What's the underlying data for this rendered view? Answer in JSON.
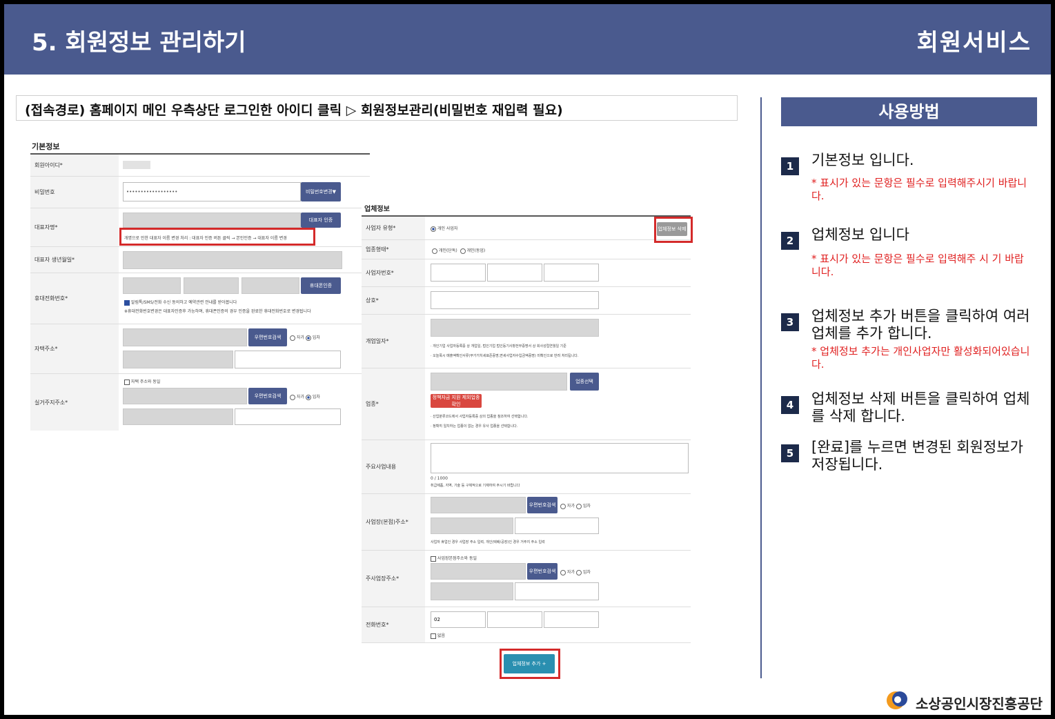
{
  "header": {
    "title": "5. 회원정보 관리하기",
    "section": "회원서비스"
  },
  "path": "(접속경로) 홈페이지 메인 우측상단 로그인한 아이디 클릭 ▷ 회원정보관리(비밀번호 재입력 필요)",
  "howto": {
    "title": "사용방법",
    "steps": [
      {
        "num": "1",
        "text": "기본정보 입니다.",
        "note": "* 표시가 있는 문항은 필수로 입력해주시기 바랍니다."
      },
      {
        "num": "2",
        "text": "업체정보 입니다",
        "note": "* 표시가 있는 문항은 필수로 입력해주 시 기 바랍니다."
      },
      {
        "num": "3",
        "text": "업체정보 추가 버튼을 클릭하여 여러 업체를 추가 합니다.",
        "note": "* 업체정보 추가는 개인사업자만 활성화되어있습니다."
      },
      {
        "num": "4",
        "text": "업체정보 삭제 버튼을 클릭하여 업체를 삭제 합니다.",
        "note": ""
      },
      {
        "num": "5",
        "text": "[완료]를 누르면 변경된 회원정보가 저장됩니다.",
        "note": ""
      }
    ]
  },
  "basic": {
    "heading": "기본정보",
    "labels": {
      "id": "회원아이디*",
      "pw": "비밀번호",
      "rep": "대표자명*",
      "birth": "대표자 생년월일*",
      "phone": "휴대전화번호*",
      "home": "자택주소*",
      "real": "실거주지주소*"
    },
    "pw_value": "••••••••••••••••••",
    "btn_pw": "비밀번호변경▼",
    "btn_rep": "대표자 인증",
    "rep_notice": "개명으로 인한 대표자 이름 변경 처리 : 대표자 인증 버튼 클릭 → 본인인증 → 대표자 이름 변경",
    "btn_phone": "휴대폰인증",
    "phone_agree": "알림톡/SMS/전화 수신 동의하고 예약관련 안내를 받아봅니다",
    "phone_notice": "※휴대전화번호변경은 대표자인증후 가능하며, 휴대폰인증의 경우 인증을 완료한 휴대전화번호로 변경됩니다",
    "btn_zip": "우편번호검색",
    "own": "자가",
    "rent": "임차",
    "same_addr": "자택 주소와 동일"
  },
  "company": {
    "heading": "업체정보",
    "labels": {
      "type": "사업자 유형*",
      "form": "업종형태*",
      "bizno": "사업자번호*",
      "name": "상호*",
      "date": "개업일자*",
      "biz": "업종*",
      "main": "주요사업내용",
      "addr1": "사업장(본점)주소*",
      "addr2": "주사업장주소*",
      "tel": "전화번호*"
    },
    "type_value": "개인 사업자",
    "form_opt1": "개인(단독)",
    "form_opt2": "개인(동업)",
    "btn_delete": "업체정보 삭제",
    "date_note1": "· 개인기업 사업자등록증 상 개업일, 법인기업 법인등기사항전부증명서 상 회사성립연월일 기준",
    "date_note2": "· 오늘폭시 매출액확인서류(부가가치세표준증명,면세사업자수입금액증명) 미확인으로 반려 처리됩니다.",
    "btn_biz": "업종선택",
    "btn_policy": "정책자금 지원 제외업종 확인",
    "biz_note1": "· 산업분류코드에서 사업자등록증 상의 업종을 참조하여 선택합니다.",
    "biz_note2": "· 정확히 일치하는 업종이 없는 경우 유사 업종을 선택합니다.",
    "counter": "0 / 1000",
    "main_note": "취급제품, 지역, 기술 등 구체적으로 기재하여 주시기 바랍니다",
    "btn_zip": "우편번호검색",
    "own": "자가",
    "rent": "임차",
    "addr_note": "사업자 휴업인 경우 사업장 주소 입력, 개인(택배/공장)인 경우 거주지 주소 입력",
    "same_addr": "사업장본점주소와 동일",
    "tel_prefix": "02",
    "tel_none": "없음",
    "btn_add": "업체정보 추가 +"
  },
  "footer": {
    "org": "소상공인시장진흥공단"
  }
}
